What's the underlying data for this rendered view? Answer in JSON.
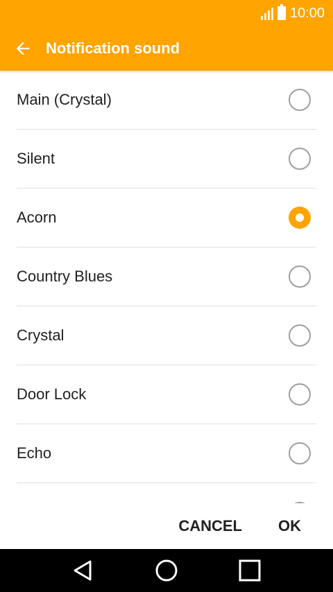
{
  "status_bar": {
    "time": "10:00"
  },
  "app_bar": {
    "title": "Notification sound"
  },
  "sounds": [
    {
      "label": "Main (Crystal)",
      "selected": false
    },
    {
      "label": "Silent",
      "selected": false
    },
    {
      "label": "Acorn",
      "selected": true
    },
    {
      "label": "Country Blues",
      "selected": false
    },
    {
      "label": "Crystal",
      "selected": false
    },
    {
      "label": "Door Lock",
      "selected": false
    },
    {
      "label": "Echo",
      "selected": false
    },
    {
      "label": "",
      "selected": false
    }
  ],
  "footer": {
    "cancel_label": "CANCEL",
    "ok_label": "OK"
  },
  "colors": {
    "accent": "#FFA400",
    "text": "#212121",
    "divider": "#e0e0e0"
  }
}
